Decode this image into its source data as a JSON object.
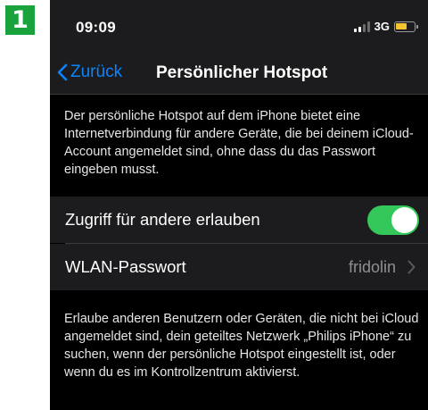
{
  "step_badge": "1",
  "status_bar": {
    "time": "09:09",
    "network": "3G",
    "icons": [
      "signal-icon",
      "battery-charging-icon"
    ],
    "battery_color": "#f4c430"
  },
  "nav": {
    "back_label": "Zurück",
    "title": "Persönlicher Hotspot",
    "accent_color": "#0a84ff"
  },
  "description": "Der persönliche Hotspot auf dem iPhone bietet eine Internetverbindung für andere Geräte, die bei deinem iCloud-Account angemeldet sind, ohne dass du das Passwort eingeben musst.",
  "settings": {
    "allow_others_label": "Zugriff für andere erlauben",
    "allow_others_on": true,
    "toggle_color": "#34c759",
    "wifi_password_label": "WLAN-Passwort",
    "wifi_password_value": "fridolin"
  },
  "footer": "Erlaube anderen Benutzern oder Geräten, die nicht bei iCloud angemeldet sind, dein geteiltes Netzwerk „Philips iPhone“ zu suchen, wenn der persönliche Hotspot eingestellt ist, oder wenn du es im Kontrollzentrum aktivierst."
}
